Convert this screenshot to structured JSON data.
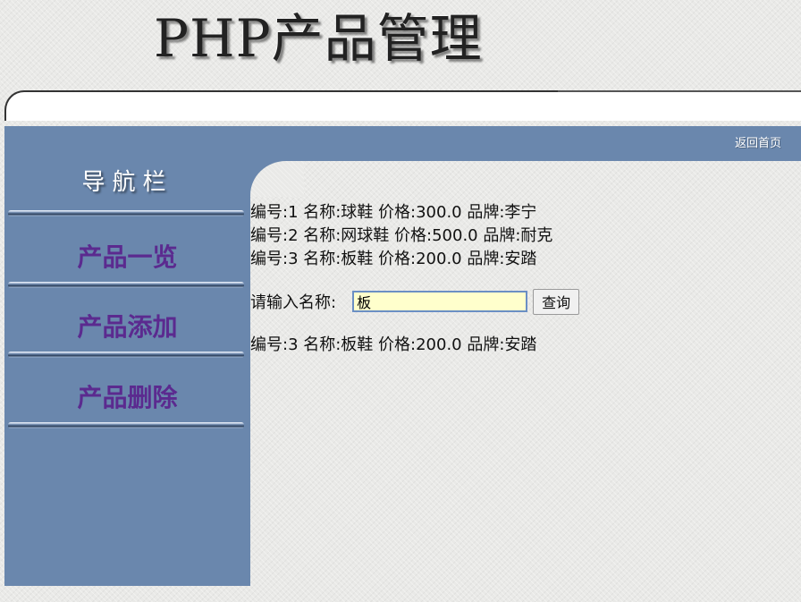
{
  "header": {
    "title": "PHP产品管理",
    "back_home": "返回首页"
  },
  "sidebar": {
    "title": "导航栏",
    "items": [
      {
        "label": "产品一览"
      },
      {
        "label": "产品添加"
      },
      {
        "label": "产品删除"
      }
    ]
  },
  "products": [
    {
      "text": "编号:1 名称:球鞋 价格:300.0 品牌:李宁"
    },
    {
      "text": "编号:2 名称:网球鞋 价格:500.0 品牌:耐克"
    },
    {
      "text": "编号:3 名称:板鞋 价格:200.0 品牌:安踏"
    }
  ],
  "search": {
    "label": "请输入名称:",
    "value": "板",
    "button_label": "查询"
  },
  "results": [
    {
      "text": "编号:3 名称:板鞋 价格:200.0 品牌:安踏"
    }
  ],
  "colors": {
    "sidebar": "#6a87ad",
    "nav_link": "#5b2a8f",
    "input_bg": "#ffffcc"
  }
}
